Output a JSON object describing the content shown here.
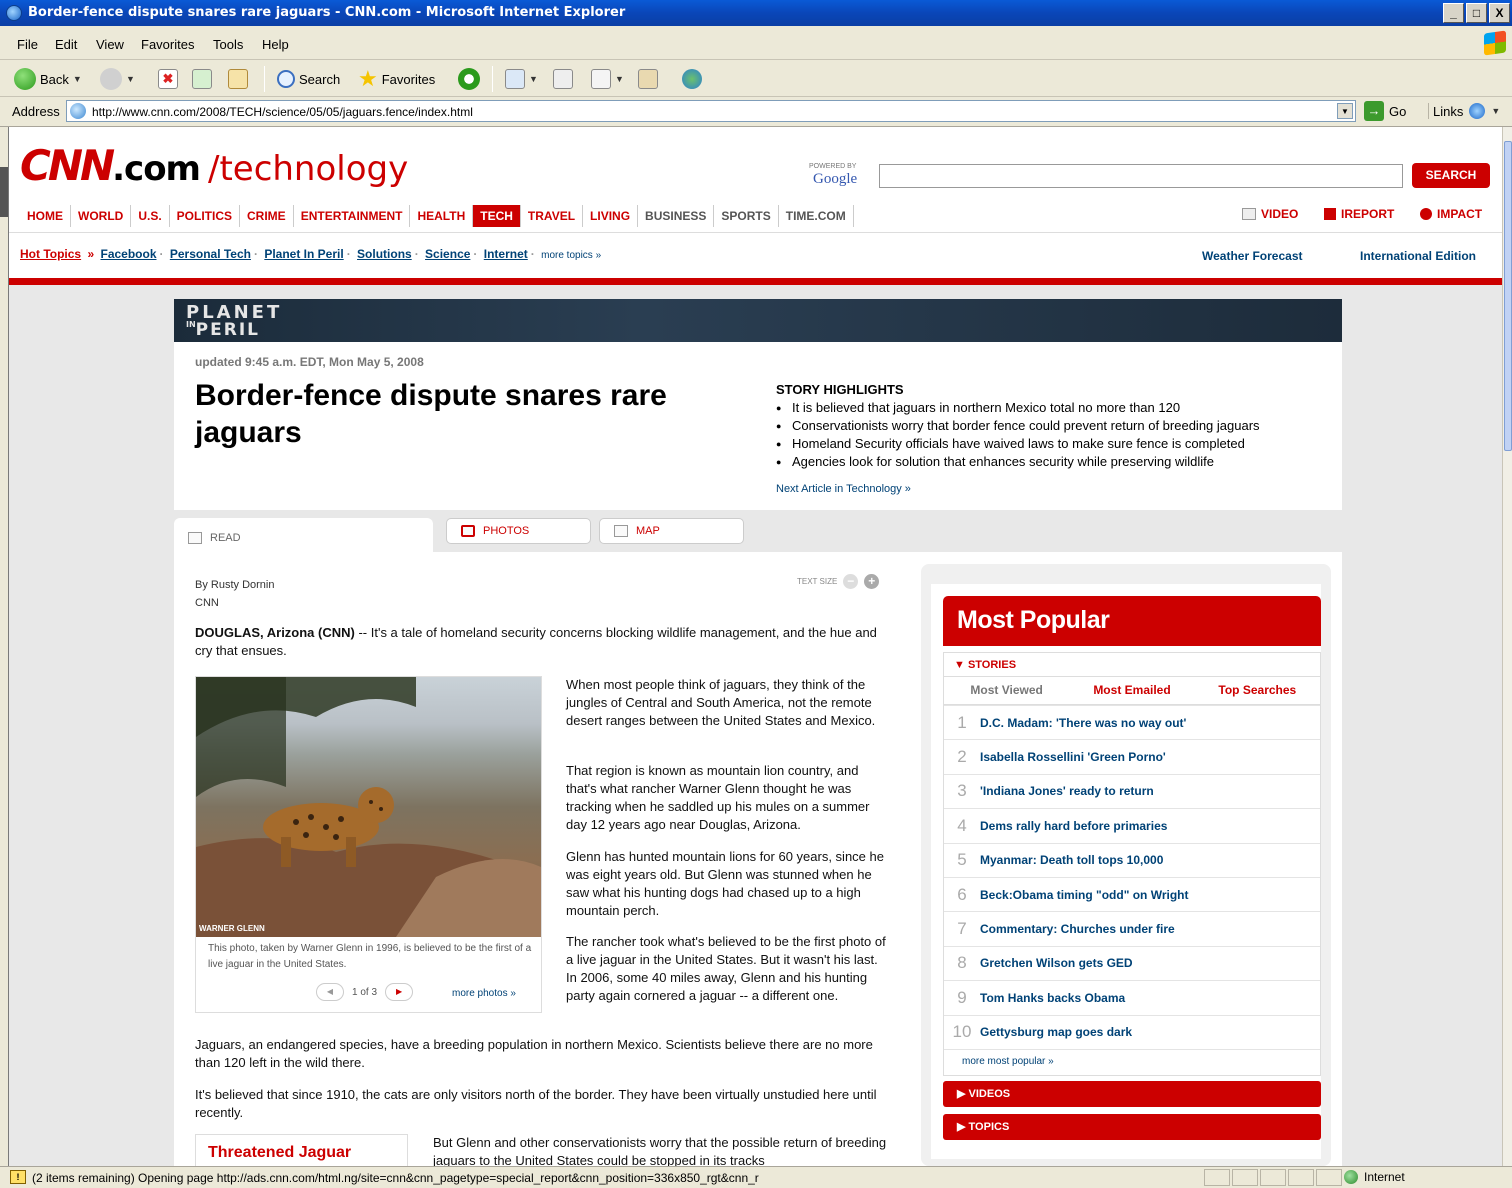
{
  "window": {
    "title": "Border-fence dispute snares rare jaguars - CNN.com - Microsoft Internet Explorer",
    "buttons": [
      "_",
      "□",
      "X"
    ]
  },
  "menu": [
    "File",
    "Edit",
    "View",
    "Favorites",
    "Tools",
    "Help"
  ],
  "toolbar": {
    "back": "Back",
    "search": "Search",
    "favorites": "Favorites"
  },
  "address": {
    "label": "Address",
    "url": "http://www.cnn.com/2008/TECH/science/05/05/jaguars.fence/index.html",
    "go": "Go",
    "links": "Links"
  },
  "cnn": {
    "logo_cnn": "CNN",
    "logo_com": ".com",
    "section": "/technology",
    "powered": "POWERED BY",
    "google": "Google",
    "search_button": "SEARCH",
    "nav": [
      "HOME",
      "WORLD",
      "U.S.",
      "POLITICS",
      "CRIME",
      "ENTERTAINMENT",
      "HEALTH",
      "TECH",
      "TRAVEL",
      "LIVING",
      "BUSINESS",
      "SPORTS",
      "TIME.COM"
    ],
    "nav_right": {
      "video": "VIDEO",
      "ireport": "IREPORT",
      "impact": "IMPACT"
    },
    "hot_topics": {
      "label": "Hot Topics",
      "sep": "»",
      "items": [
        "Facebook",
        "Personal Tech",
        "Planet In Peril",
        "Solutions",
        "Science",
        "Internet"
      ],
      "more": "more topics »"
    },
    "weather": "Weather Forecast",
    "international": "International Edition"
  },
  "banner": {
    "line1": "PLANET",
    "line2_small": "IN",
    "line2": "PERIL"
  },
  "story": {
    "updated": "updated 9:45 a.m. EDT, Mon May 5, 2008",
    "headline": "Border-fence dispute snares rare jaguars",
    "highlights_title": "STORY HIGHLIGHTS",
    "highlights": [
      "It is believed that jaguars in northern Mexico total no more than 120",
      "Conservationists worry that border fence could prevent return of breeding jaguars",
      "Homeland Security officials have waived laws to make sure fence is completed",
      "Agencies look for solution that enhances security while preserving wildlife"
    ],
    "next_article": "Next Article in Technology »"
  },
  "tabs": {
    "read": "READ",
    "photos": "PHOTOS",
    "map": "MAP"
  },
  "article": {
    "byline": "By Rusty Dornin",
    "source": "CNN",
    "text_size": "TEXT SIZE",
    "lead_bold": "DOUGLAS, Arizona (CNN)",
    "lead": " -- It's a tale of homeland security concerns blocking wildlife management, and the hue and cry that ensues.",
    "p1": "When most people think of jaguars, they think of the jungles of Central and South America, not the remote desert ranges between the United States and Mexico.",
    "p2": "That region is known as mountain lion country, and that's what rancher Warner Glenn thought he was tracking when he saddled up his mules on a summer day 12 years ago near Douglas, Arizona.",
    "p3": "Glenn has hunted mountain lions for 60 years, since he was eight years old. But Glenn was stunned when he saw what his hunting dogs had chased up to a high mountain perch.",
    "p4": "The rancher took what's believed to be the first photo of a live jaguar in the United States. But it wasn't his last. In 2006, some 40 miles away, Glenn and his hunting party again cornered a jaguar -- a different one.",
    "p5": "Jaguars, an endangered species, have a breeding population in northern Mexico. Scientists believe there are no more than 120 left in the wild there.",
    "p6": "It's believed that since 1910, the cats are only visitors north of the border. They have been virtually unstudied here until recently.",
    "p7": "But Glenn and other conservationists worry that the possible return of breeding jaguars to the United States could be stopped in its tracks",
    "photo_credit": "WARNER GLENN",
    "caption": "This photo, taken by Warner Glenn in 1996, is believed to be the first of a live jaguar in the United States.",
    "pager": "1 of 3",
    "more_photos": "more photos »",
    "threatened": "Threatened Jaguar"
  },
  "popular": {
    "title": "Most Popular",
    "stories": "STORIES",
    "tabs": [
      "Most Viewed",
      "Most Emailed",
      "Top Searches"
    ],
    "items": [
      "D.C. Madam: 'There was no way out'",
      "Isabella Rossellini 'Green Porno'",
      "'Indiana Jones' ready to return",
      "Dems rally hard before primaries",
      "Myanmar: Death toll tops 10,000",
      "Beck:Obama timing \"odd\" on Wright",
      "Commentary: Churches under fire",
      "Gretchen Wilson gets GED",
      "Tom Hanks backs Obama",
      "Gettysburg map goes dark"
    ],
    "more": "more most popular »",
    "videos": "VIDEOS",
    "topics": "TOPICS"
  },
  "status": {
    "message": "(2 items remaining) Opening page http://ads.cnn.com/html.ng/site=cnn&cnn_pagetype=special_report&cnn_position=336x850_rgt&cnn_r",
    "zone": "Internet"
  }
}
